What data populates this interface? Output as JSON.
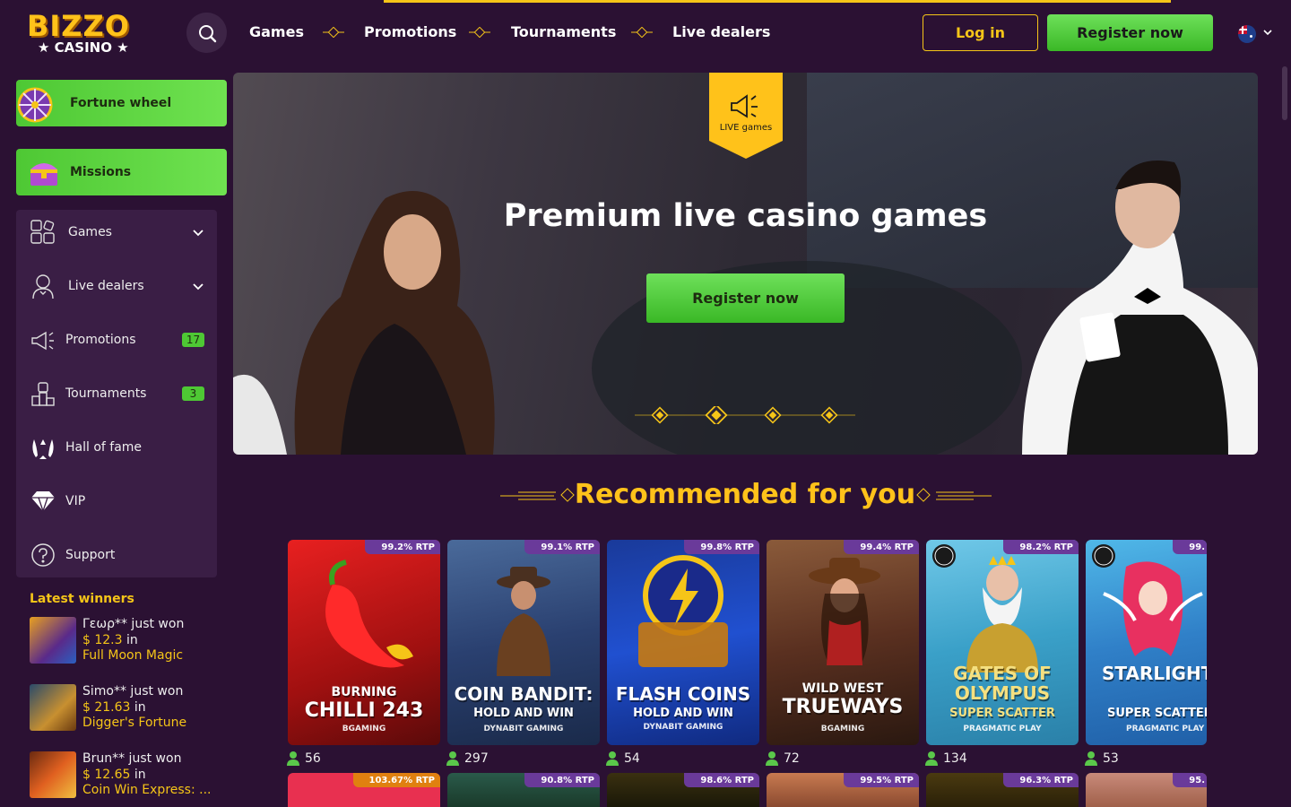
{
  "header": {
    "logo_line1": "BIZZO",
    "logo_line2": "★ CASINO ★",
    "nav": [
      "Games",
      "Promotions",
      "Tournaments",
      "Live dealers"
    ],
    "login": "Log in",
    "register": "Register now"
  },
  "sidebar": {
    "fortune_wheel": "Fortune wheel",
    "missions": "Missions",
    "items": [
      {
        "label": "Games",
        "icon": "puzzle-icon"
      },
      {
        "label": "Live dealers",
        "icon": "dealer-icon"
      },
      {
        "label": "Promotions",
        "icon": "megaphone-icon",
        "badge": "17"
      },
      {
        "label": "Tournaments",
        "icon": "trophy-icon",
        "badge": "3"
      },
      {
        "label": "Hall of fame",
        "icon": "laurel-icon"
      },
      {
        "label": "VIP",
        "icon": "diamond-icon"
      },
      {
        "label": "Support",
        "icon": "help-icon"
      }
    ]
  },
  "latest_winners": {
    "title": "Latest winners",
    "items": [
      {
        "user": "Γεωρ** just won",
        "amount": "$ 12.3",
        "in": "in",
        "game": "Full Moon Magic"
      },
      {
        "user": "Simo** just won",
        "amount": "$ 21.63",
        "in": "in",
        "game": "Digger's Fortune"
      },
      {
        "user": "Brun** just won",
        "amount": "$ 12.65",
        "in": "in",
        "game": "Coin Win Express: ..."
      }
    ]
  },
  "hero": {
    "badge": "LIVE games",
    "title": "Premium live casino games",
    "button": "Register now"
  },
  "recommended": {
    "title": "Recommended for you",
    "games": [
      {
        "title1": "BURNING",
        "title2": "CHILLI 243",
        "provider": "BGAMING",
        "rtp": "99.2% RTP",
        "players": "56"
      },
      {
        "title1": "COIN BANDIT:",
        "title2": "HOLD AND WIN",
        "provider": "DYNABIT GAMING",
        "rtp": "99.1% RTP",
        "players": "297"
      },
      {
        "title1": "FLASH COINS",
        "title2": "HOLD AND WIN",
        "provider": "DYNABIT GAMING",
        "rtp": "99.8% RTP",
        "players": "54"
      },
      {
        "title1": "WILD WEST",
        "title2": "TRUEWAYS",
        "provider": "BGAMING",
        "rtp": "99.4% RTP",
        "players": "72"
      },
      {
        "title1": "GATES OF OLYMPUS",
        "title2": "SUPER SCATTER",
        "provider": "PRAGMATIC PLAY",
        "rtp": "98.2% RTP",
        "players": "134"
      },
      {
        "title1": "STARLIGHT PRINCESS",
        "title2": "SUPER SCATTER",
        "provider": "PRAGMATIC PLAY",
        "rtp": "99.",
        "players": "53"
      }
    ],
    "row2_rtp": [
      "103.67% RTP",
      "90.8% RTP",
      "98.6% RTP",
      "99.5% RTP",
      "96.3% RTP",
      "95."
    ]
  }
}
